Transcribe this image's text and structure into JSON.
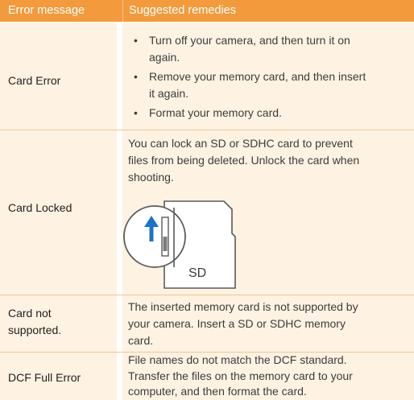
{
  "header": {
    "col1": "Error message",
    "col2": "Suggested remedies"
  },
  "rows": [
    {
      "label": "Card Error",
      "bullet": "•",
      "items": [
        [
          "Turn off your camera, and then turn it on",
          "again."
        ],
        [
          "Remove your memory card, and then insert",
          "it again."
        ],
        [
          "Format your memory card."
        ]
      ]
    },
    {
      "label": "Card Locked",
      "lines": [
        "You can lock an SD or SDHC card to prevent",
        "files from being deleted. Unlock the card when",
        "shooting."
      ],
      "card_text": "SD"
    },
    {
      "label_lines": [
        "Card not",
        "supported."
      ],
      "lines": [
        "The inserted memory card is not supported by",
        "your camera. Insert a SD or SDHC memory",
        "card."
      ]
    },
    {
      "label": "DCF Full Error",
      "lines": [
        "File names do not match the DCF standard.",
        "Transfer the files on the memory card to your",
        "computer, and then format the card."
      ]
    }
  ],
  "colors": {
    "header_bg": "#f29a3c",
    "row_bg": "#fef2e2",
    "divider": "#f1c58f",
    "accent_blue": "#1a73c8"
  }
}
